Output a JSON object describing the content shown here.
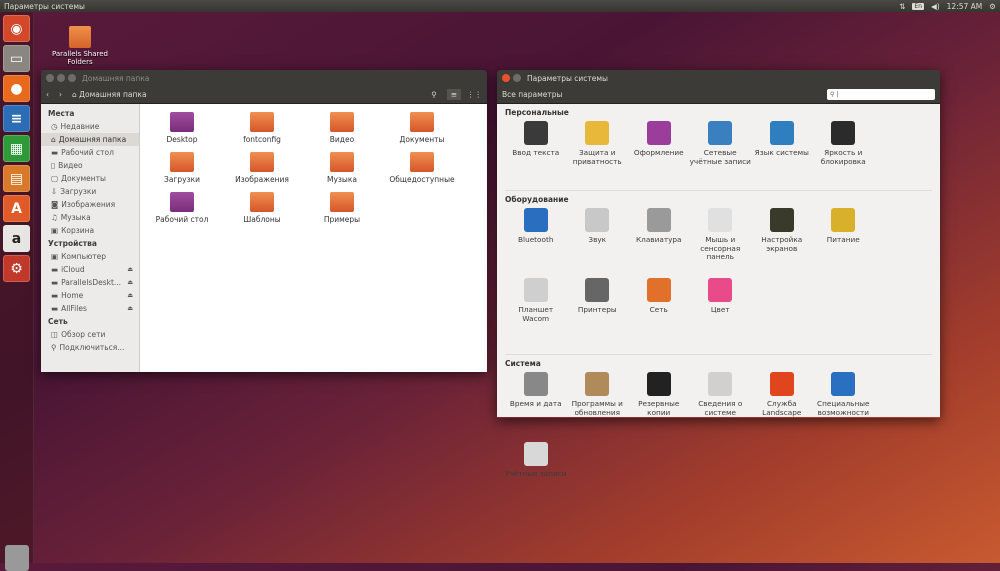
{
  "topbar": {
    "title": "Параметры системы",
    "keyboard": "En",
    "time": "12:57 AM"
  },
  "desktop": {
    "icon_label": "Parallels Shared Folders"
  },
  "launcher": [
    {
      "name": "dash",
      "color": "#d3472b",
      "glyph": "◉"
    },
    {
      "name": "files",
      "color": "#8a8680",
      "glyph": "▭"
    },
    {
      "name": "firefox",
      "color": "#e86a1c",
      "glyph": "●"
    },
    {
      "name": "writer",
      "color": "#2d6db5",
      "glyph": "≡"
    },
    {
      "name": "calc",
      "color": "#2f9a3a",
      "glyph": "▦"
    },
    {
      "name": "impress",
      "color": "#d97a2a",
      "glyph": "▤"
    },
    {
      "name": "software-center",
      "color": "#e05b27",
      "glyph": "A"
    },
    {
      "name": "amazon",
      "color": "#e8e6e2",
      "glyph": "a"
    },
    {
      "name": "system-settings",
      "color": "#c0392b",
      "glyph": "⚙"
    }
  ],
  "files": {
    "title": "Домашняя папка",
    "path": "Домашняя папка",
    "sidebar": [
      {
        "type": "h",
        "label": "Места"
      },
      {
        "label": "Недавние",
        "icon": "◷"
      },
      {
        "label": "Домашняя папка",
        "icon": "⌂",
        "sel": true
      },
      {
        "label": "Рабочий стол",
        "icon": "▬"
      },
      {
        "label": "Видео",
        "icon": "▯"
      },
      {
        "label": "Документы",
        "icon": "▢"
      },
      {
        "label": "Загрузки",
        "icon": "⇩"
      },
      {
        "label": "Изображения",
        "icon": "◙"
      },
      {
        "label": "Музыка",
        "icon": "♫"
      },
      {
        "label": "Корзина",
        "icon": "▣"
      },
      {
        "type": "h",
        "label": "Устройства"
      },
      {
        "label": "Компьютер",
        "icon": "▣"
      },
      {
        "label": "iCloud",
        "icon": "▬",
        "eject": true
      },
      {
        "label": "ParallelsDeskt...",
        "icon": "▬",
        "eject": true
      },
      {
        "label": "Home",
        "icon": "▬",
        "eject": true
      },
      {
        "label": "AllFiles",
        "icon": "▬",
        "eject": true
      },
      {
        "type": "h",
        "label": "Сеть"
      },
      {
        "label": "Обзор сети",
        "icon": "◫"
      },
      {
        "label": "Подключиться...",
        "icon": "⚲"
      }
    ],
    "items": [
      {
        "label": "Desktop",
        "purple": true
      },
      {
        "label": "fontconfig"
      },
      {
        "label": "Видео"
      },
      {
        "label": "Документы"
      },
      {
        "label": "Загрузки"
      },
      {
        "label": "Изображения"
      },
      {
        "label": "Музыка"
      },
      {
        "label": "Общедоступные"
      },
      {
        "label": "Рабочий стол",
        "purple": true
      },
      {
        "label": "Шаблоны"
      },
      {
        "label": "Примеры"
      }
    ]
  },
  "settings": {
    "title": "Параметры системы",
    "all_button": "Все параметры",
    "search_value": "",
    "sections": [
      {
        "title": "Персональные",
        "items": [
          {
            "label": "Ввод текста",
            "color": "#3a3a3a"
          },
          {
            "label": "Защита и приватность",
            "color": "#e8b83a"
          },
          {
            "label": "Оформление",
            "color": "#9b3d9b"
          },
          {
            "label": "Сетевые учётные записи",
            "color": "#3a7fbf"
          },
          {
            "label": "Язык системы",
            "color": "#2f7fc0"
          },
          {
            "label": "Яркость и блокировка",
            "color": "#2b2b2b"
          }
        ]
      },
      {
        "title": "Оборудование",
        "items": [
          {
            "label": "Bluetooth",
            "color": "#2a6fbf"
          },
          {
            "label": "Звук",
            "color": "#c8c8c8"
          },
          {
            "label": "Клавиатура",
            "color": "#9a9a9a"
          },
          {
            "label": "Мышь и сенсорная панель",
            "color": "#e0e0e0"
          },
          {
            "label": "Настройка экранов",
            "color": "#3a3a2a"
          },
          {
            "label": "Питание",
            "color": "#d8b02a"
          },
          {
            "label": "Планшет Wacom",
            "color": "#cfcfcf"
          },
          {
            "label": "Принтеры",
            "color": "#666"
          },
          {
            "label": "Сеть",
            "color": "#e0702a"
          },
          {
            "label": "Цвет",
            "color": "#e84a8a"
          }
        ]
      },
      {
        "title": "Система",
        "items": [
          {
            "label": "Время и дата",
            "color": "#888"
          },
          {
            "label": "Программы и обновления",
            "color": "#b08a5a"
          },
          {
            "label": "Резервные копии",
            "color": "#222"
          },
          {
            "label": "Сведения о системе",
            "color": "#d0d0d0"
          },
          {
            "label": "Служба Landscape",
            "color": "#e0461e"
          },
          {
            "label": "Специальные возможности",
            "color": "#2a6fc0"
          },
          {
            "label": "Учётные записи",
            "color": "#d8d8d8"
          }
        ]
      }
    ]
  }
}
